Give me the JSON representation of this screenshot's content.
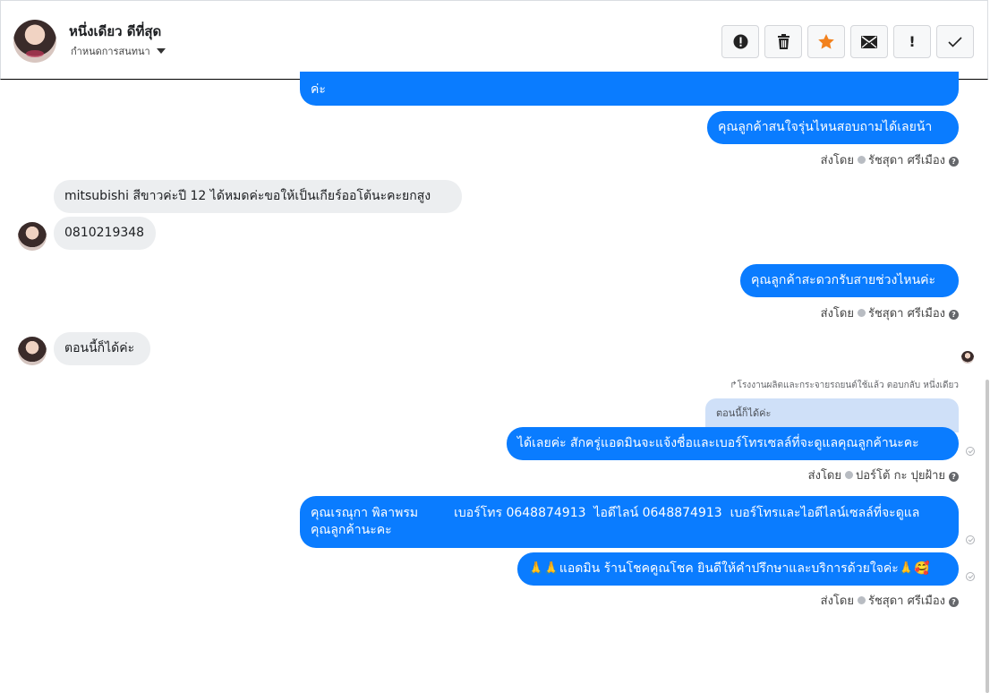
{
  "header": {
    "contact_name": "หนึ่งเดียว ดีที่สุด",
    "assign_label": "กำหนดการสนทนา",
    "toolbar": {
      "spam": "!",
      "trash": "🗑",
      "star": "★",
      "mail": "✉",
      "alert": "!",
      "done": "✓"
    }
  },
  "messages": {
    "m0_text": "ค่ะ",
    "m1_text": "คุณลูกค้าสนใจรุ่นไหนสอบถามได้เลยน้า",
    "m1_sent_prefix": "ส่งโดย",
    "m1_sender": "รัชสุดา ศรีเมือง",
    "m2_text": "mitsubishi สีขาวค่ะปี 12 ได้หมดค่ะขอให้เป็นเกียร์ออโต้นะคะยกสูง",
    "m3_text": "0810219348",
    "m4_text": "คุณลูกค้าสะดวกรับสายช่วงไหนค่ะ",
    "m4_sent_prefix": "ส่งโดย",
    "m4_sender": "รัชสุดา ศรีเมือง",
    "m5_text": "ตอนนี้ก็ได้ค่ะ",
    "reply_note": "↱โรงงานผลิตและกระจายรถยนต์ใช้แล้ว ตอบกลับ หนึ่งเดียว",
    "quoted_text": "ตอนนี้ก็ได้ค่ะ",
    "m6_text": "ได้เลยค่ะ สักครู่แอดมินจะแจ้งชื่อและเบอร์โทรเซลล์ที่จะดูแลคุณลูกค้านะคะ",
    "m6_sent_prefix": "ส่งโดย",
    "m6_sender": "ปอร์โต้ กะ ปุยฝ้าย",
    "m7_line1": "คุณเรณุกา พิลาพรม         เบอร์โทร 0648874913  ไอดีไลน์ 0648874913  เบอร์โทรและไอดีไลน์เซลล์ที่จะดูแล",
    "m7_line2": "คุณลูกค้านะคะ",
    "m8_text": "🙏🙏แอดมิน ร้านโชคคูณโชค ยินดีให้คำปรึกษาและบริการด้วยใจค่ะ🙏🥰",
    "m8_sent_prefix": "ส่งโดย",
    "m8_sender": "รัชสุดา ศรีเมือง"
  },
  "icons": {
    "help": "?"
  },
  "colors": {
    "outgoing": "#0a7cff",
    "incoming": "#eceef0",
    "star": "#f2811d"
  }
}
